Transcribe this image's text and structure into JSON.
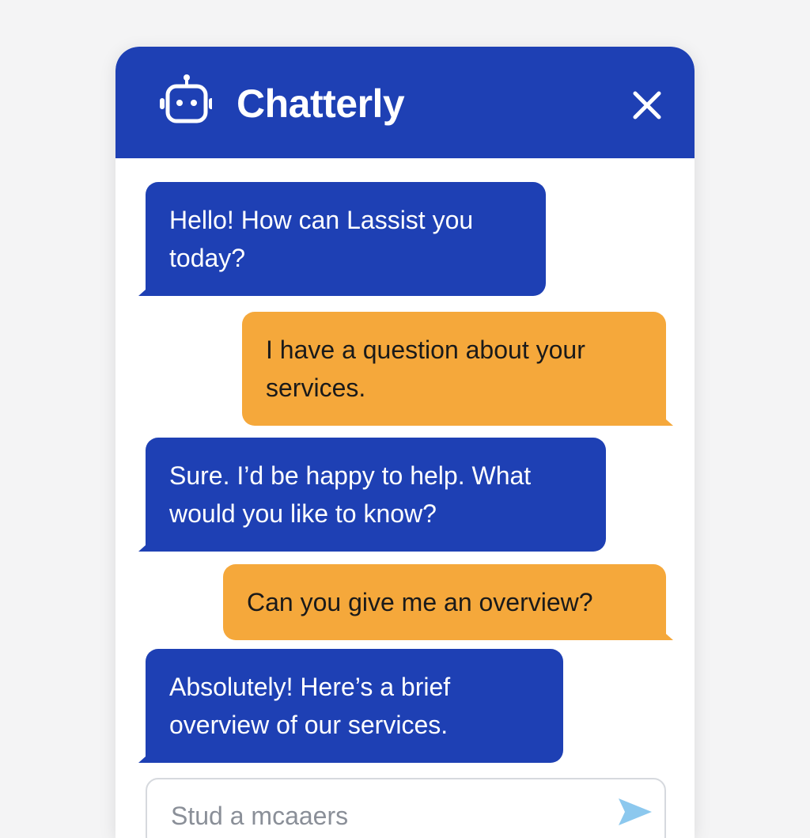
{
  "header": {
    "title": "Chatterly",
    "bot_icon": "robot-icon",
    "close_icon": "close-icon"
  },
  "messages": [
    {
      "sender": "bot",
      "text": "Hello! How can Lassist you today?"
    },
    {
      "sender": "user",
      "text": "I have a question about your services."
    },
    {
      "sender": "bot",
      "text": "Sure. I’d be happy to help. What would you like to know?"
    },
    {
      "sender": "user",
      "text": "Can you give me an overview?"
    },
    {
      "sender": "bot",
      "text": "Absolutely! Here’s a brief overview of our services."
    }
  ],
  "composer": {
    "placeholder": "Stud a mcaaers",
    "value": "",
    "send_icon": "send-icon"
  },
  "colors": {
    "primary": "#1e40b4",
    "user_bubble": "#f5a83b",
    "background": "#f4f4f5",
    "send_accent": "#8cc8ee"
  }
}
